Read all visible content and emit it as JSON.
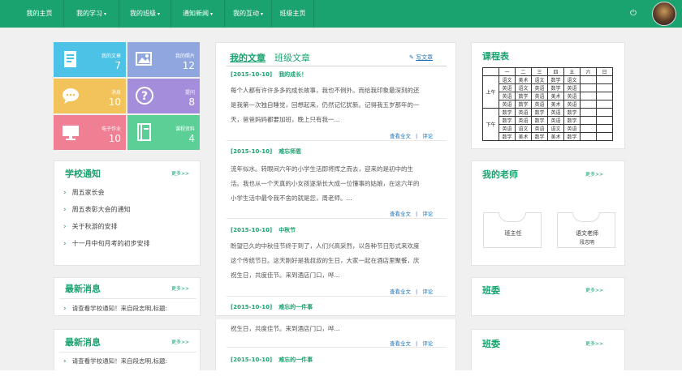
{
  "nav": {
    "items": [
      {
        "label": "我的主页",
        "has_caret": false
      },
      {
        "label": "我的学习",
        "has_caret": true
      },
      {
        "label": "我的班级",
        "has_caret": true
      },
      {
        "label": "通知新闻",
        "has_caret": true
      },
      {
        "label": "我的互动",
        "has_caret": true
      },
      {
        "label": "班级主页",
        "has_caret": false
      }
    ],
    "power_icon": "power-icon",
    "avatar_icon": "avatar"
  },
  "tiles": [
    {
      "label": "我的文章",
      "count": "7",
      "color": "#4cc3e6",
      "icon": "document-icon"
    },
    {
      "label": "我的照片",
      "count": "12",
      "color": "#8fa6df",
      "icon": "photo-icon"
    },
    {
      "label": "消息",
      "count": "10",
      "color": "#f2c35a",
      "icon": "chat-bubble-icon"
    },
    {
      "label": "提问",
      "count": "8",
      "color": "#a48edc",
      "icon": "question-icon"
    },
    {
      "label": "电子作业",
      "count": "10",
      "color": "#f07f94",
      "icon": "monitor-icon"
    },
    {
      "label": "课程资料",
      "count": "4",
      "color": "#5ccf97",
      "icon": "book-icon"
    }
  ],
  "school_notice": {
    "title": "学校通知",
    "more": "更多>>",
    "items": [
      "周五家长会",
      "周五表彰大会的通知",
      "关于秋游的安排",
      "十一月中旬月考的初步安排"
    ]
  },
  "latest_news": {
    "title": "最新消息",
    "more": "更多>>",
    "items": [
      "请查看学校通知！来自段志明,标题:"
    ]
  },
  "latest_news_2": {
    "title": "最新消息",
    "more": "更多>>",
    "items": [
      "请查看学校通知！来自段志明,标题:"
    ]
  },
  "articles": {
    "tab_active": "我的文章",
    "tab_inactive": "班级文章",
    "write_label": "写文章",
    "read_more": "查看全文",
    "comment": "评论",
    "items": [
      {
        "date": "[2015-10-10]",
        "title": "我的成长！",
        "body": [
          "每个人都有许许多多的成长故事，我也不例外。而给我印象最深刻的还",
          "是我第一次独自睡觉，回想起来，仍然记忆犹新。记得我五岁那年的一",
          "天，爸爸妈妈都要加班，晚上只有我一..."
        ]
      },
      {
        "date": "[2015-10-10]",
        "title": "难忘师恩",
        "body": [
          "流年似水。转眼间六年的小学生活即将挥之而去，迎来的是初中的生",
          "活。我也从一个天真的小女孩逐渐长大成一位懂事的姑娘，在这六年的",
          "小学生活中最令我不舍的就是您，周老师。..."
        ]
      },
      {
        "date": "[2015-10-10]",
        "title": "中秋节",
        "body": [
          "盼望已久的中秋佳节终于到了，人们兴高采烈，以各种节日形式来欢度",
          "这个传统节日。这天刚好是我叔叔的生日，大家一起在酒店里聚餐，庆",
          "祝生日，共度佳节。来到酒店门口，哗..."
        ]
      },
      {
        "date": "[2015-10-10]",
        "title": "难忘的一件事",
        "body": []
      }
    ],
    "overflow": {
      "body": "祝生日，共度佳节。来到酒店门口，哗...",
      "date": "[2015-10-10]",
      "title": "难忘的一件事"
    }
  },
  "schedule": {
    "title": "课程表",
    "header": [
      "一",
      "二",
      "三",
      "四",
      "五",
      "六",
      "日"
    ],
    "am_label": "上午",
    "pm_label": "下午",
    "am_rows": [
      [
        "语文",
        "美术",
        "语文",
        "数学",
        "语文",
        "",
        ""
      ],
      [
        "英语",
        "语文",
        "英语",
        "数学",
        "英语",
        "",
        ""
      ],
      [
        "英语",
        "数学",
        "英语",
        "美术",
        "英语",
        "",
        ""
      ],
      [
        "英语",
        "数学",
        "英语",
        "美术",
        "英语",
        "",
        ""
      ]
    ],
    "pm_rows": [
      [
        "数学",
        "英语",
        "数学",
        "英语",
        "数学",
        "",
        ""
      ],
      [
        "数学",
        "英语",
        "数学",
        "英语",
        "数学",
        "",
        ""
      ],
      [
        "英语",
        "语文",
        "英语",
        "语文",
        "英语",
        "",
        ""
      ],
      [
        "数学",
        "美术",
        "数学",
        "美术",
        "数学",
        "",
        ""
      ]
    ]
  },
  "teachers": {
    "title": "我的老师",
    "more": "更多>>",
    "items": [
      {
        "role": "班主任",
        "name": ""
      },
      {
        "role": "语文老师",
        "name": "段志明"
      }
    ]
  },
  "monitor": {
    "title": "班委",
    "more": "更多>>"
  },
  "monitor_2": {
    "title": "班委",
    "more": "更多>>"
  }
}
